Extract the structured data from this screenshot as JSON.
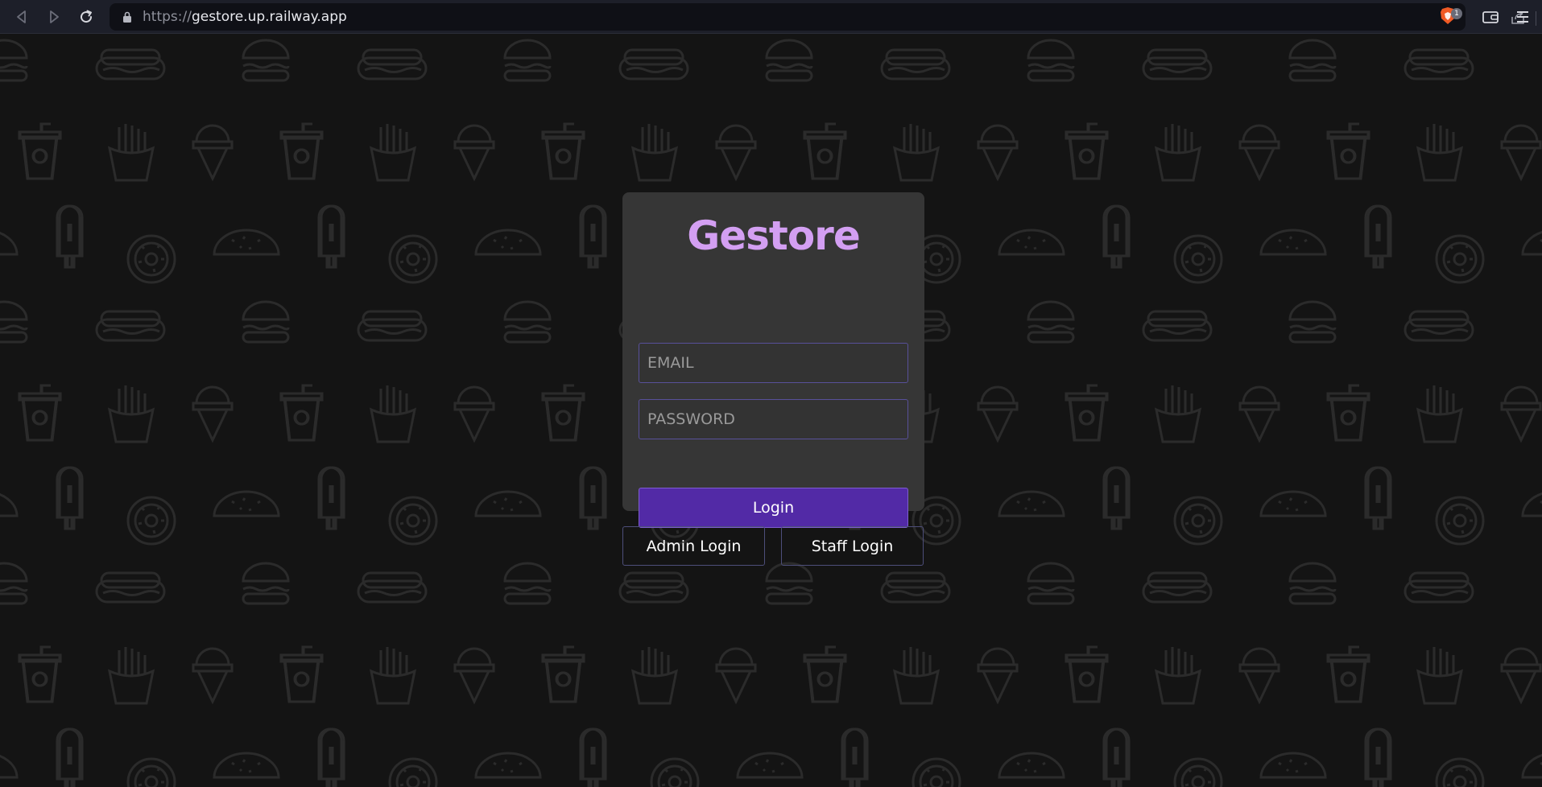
{
  "browser": {
    "url_scheme": "https://",
    "url_host": "gestore.up.railway.app",
    "shields_count": "1",
    "colors": {
      "chrome": "#1d1f29",
      "url_bar": "#0f1016"
    },
    "icons": [
      "back-icon",
      "forward-icon",
      "reload-icon",
      "lock-icon",
      "share-icon",
      "brave-shields-icon",
      "wallet-icon",
      "menu-icon"
    ]
  },
  "page": {
    "background_color": "#141414",
    "pattern_icons": [
      "hotdog-icon",
      "burger-icon",
      "soda-cup-icon",
      "fries-icon",
      "ice-cream-cone-icon",
      "popsicle-icon",
      "donut-icon",
      "taco-icon"
    ]
  },
  "login": {
    "brand": "Gestore",
    "brand_color": "#d39ff2",
    "email_placeholder": "EMAIL",
    "password_placeholder": "PASSWORD",
    "login_label": "Login",
    "login_color": "#522aa6",
    "card_color": "#363636"
  },
  "alt_logins": {
    "admin_label": "Admin Login",
    "staff_label": "Staff Login"
  }
}
